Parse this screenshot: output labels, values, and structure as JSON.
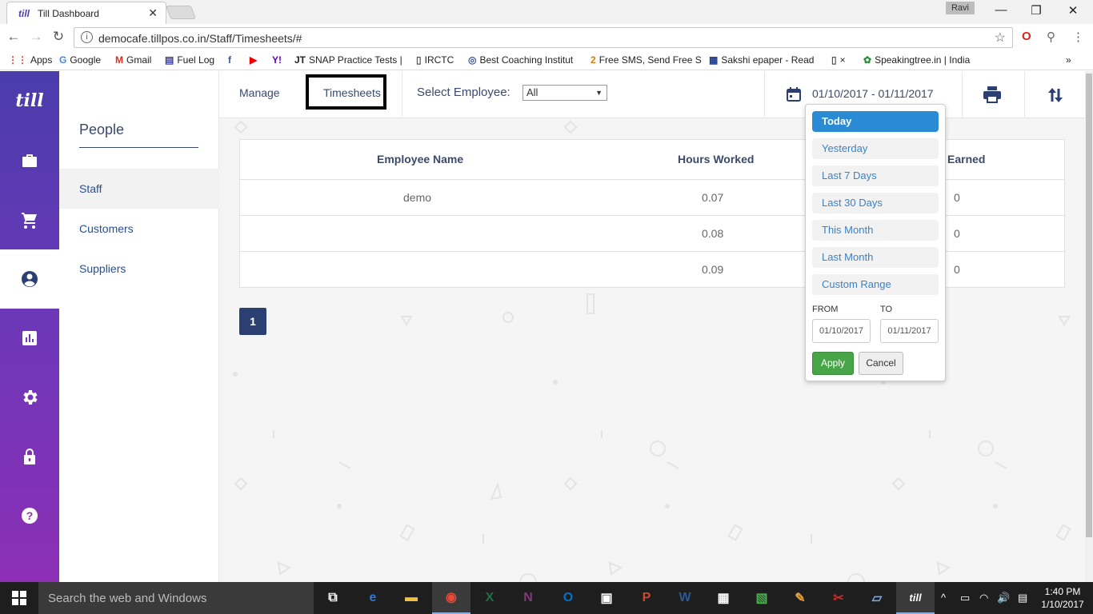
{
  "browser": {
    "tab_title": "Till Dashboard",
    "tab_favicon": "till",
    "close_glyph": "✕",
    "profile_name": "Ravi",
    "url": "democafe.tillpos.co.in/Staff/Timesheets/#",
    "window_controls": {
      "minimize": "—",
      "restore": "❐",
      "close": "✕"
    },
    "nav": {
      "back": "←",
      "forward": "→",
      "reload": "↻"
    },
    "star": "☆",
    "overflow": "⋮",
    "bookmarks_overflow": "»"
  },
  "bookmarks": [
    {
      "label": "Apps",
      "icon": "apps-grid-icon",
      "glyph": "⋮⋮",
      "color": "#e0452b"
    },
    {
      "label": "Google",
      "icon": "google-icon",
      "glyph": "G",
      "color": "#4285f4"
    },
    {
      "label": "Gmail",
      "icon": "gmail-icon",
      "glyph": "M",
      "color": "#d93025"
    },
    {
      "label": "Fuel Log",
      "icon": "fuel-log-icon",
      "glyph": "▤",
      "color": "#3a3a9a"
    },
    {
      "label": "",
      "icon": "facebook-icon",
      "glyph": "f",
      "color": "#3b5998"
    },
    {
      "label": "",
      "icon": "youtube-icon",
      "glyph": "▶",
      "color": "#e00"
    },
    {
      "label": "",
      "icon": "yahoo-icon",
      "glyph": "Y!",
      "color": "#6001d2"
    },
    {
      "label": "SNAP Practice Tests |",
      "icon": "jt-icon",
      "glyph": "JT",
      "color": "#222"
    },
    {
      "label": "IRCTC",
      "icon": "page-icon",
      "glyph": "▯",
      "color": "#555"
    },
    {
      "label": "Best Coaching Institut",
      "icon": "coaching-icon",
      "glyph": "◎",
      "color": "#3a5a9a"
    },
    {
      "label": "Free SMS, Send Free S",
      "icon": "sms-icon",
      "glyph": "2",
      "color": "#e07b00"
    },
    {
      "label": "Sakshi epaper - Read",
      "icon": "sakshi-icon",
      "glyph": "▦",
      "color": "#1a3a8a"
    },
    {
      "label": "×",
      "icon": "page-icon",
      "glyph": "▯",
      "color": "#555"
    },
    {
      "label": "Speakingtree.in | India",
      "icon": "tree-icon",
      "glyph": "✿",
      "color": "#2a8a3a"
    }
  ],
  "app": {
    "logo": "till",
    "rail": [
      {
        "name": "rail-sales",
        "icon": "briefcase-icon",
        "active": false
      },
      {
        "name": "rail-cart",
        "icon": "cart-icon",
        "active": false
      },
      {
        "name": "rail-people",
        "icon": "person-icon",
        "active": true
      },
      {
        "name": "rail-reports",
        "icon": "chart-icon",
        "active": false
      },
      {
        "name": "rail-settings",
        "icon": "gear-icon",
        "active": false
      },
      {
        "name": "rail-lock",
        "icon": "lock-icon",
        "active": false
      },
      {
        "name": "rail-help",
        "icon": "help-icon",
        "active": false
      }
    ],
    "subnav_title": "People",
    "subnav_items": [
      "Staff",
      "Customers",
      "Suppliers"
    ],
    "topbar": {
      "tab_manage": "Manage",
      "tab_timesheets": "Timesheets",
      "select_label": "Select Employee:",
      "select_value": "All",
      "date_range": "01/10/2017 - 01/11/2017"
    },
    "table": {
      "headers": [
        "Employee Name",
        "Hours Worked",
        "Earned"
      ],
      "rows": [
        {
          "name": "demo",
          "hours": "0.07",
          "earned": "0"
        },
        {
          "name": "",
          "hours": "0.08",
          "earned": "0"
        },
        {
          "name": "",
          "hours": "0.09",
          "earned": "0"
        }
      ]
    },
    "pagination": {
      "current": "1"
    },
    "date_picker": {
      "ranges": [
        "Today",
        "Yesterday",
        "Last 7 Days",
        "Last 30 Days",
        "This Month",
        "Last Month",
        "Custom Range"
      ],
      "from_label": "FROM",
      "to_label": "TO",
      "from_value": "01/10/2017",
      "to_value": "01/11/2017",
      "apply": "Apply",
      "cancel": "Cancel"
    }
  },
  "taskbar": {
    "search_placeholder": "Search the web and Windows",
    "time": "1:40 PM",
    "date": "1/10/2017",
    "apps": [
      {
        "name": "task-view-icon",
        "glyph": "⧉",
        "color": "#fff",
        "running": false
      },
      {
        "name": "edge-icon",
        "glyph": "e",
        "color": "#3277d3",
        "running": false
      },
      {
        "name": "file-explorer-icon",
        "glyph": "▬",
        "color": "#f0c040",
        "running": false
      },
      {
        "name": "chrome-icon",
        "glyph": "◉",
        "color": "#e84a3a",
        "running": true
      },
      {
        "name": "excel-icon",
        "glyph": "X",
        "color": "#1e7145",
        "running": false
      },
      {
        "name": "onenote-icon",
        "glyph": "N",
        "color": "#80397b",
        "running": false
      },
      {
        "name": "outlook-icon",
        "glyph": "O",
        "color": "#0072c6",
        "running": false
      },
      {
        "name": "store-icon",
        "glyph": "▣",
        "color": "#fff",
        "running": false
      },
      {
        "name": "powerpoint-icon",
        "glyph": "P",
        "color": "#d24726",
        "running": false
      },
      {
        "name": "word-icon",
        "glyph": "W",
        "color": "#2b5797",
        "running": false
      },
      {
        "name": "calculator-icon",
        "glyph": "▦",
        "color": "#fff",
        "running": false
      },
      {
        "name": "photos-icon",
        "glyph": "▧",
        "color": "#4caf50",
        "running": false
      },
      {
        "name": "paint-icon",
        "glyph": "✎",
        "color": "#e0a040",
        "running": false
      },
      {
        "name": "tools-icon",
        "glyph": "✂",
        "color": "#c03030",
        "running": false
      },
      {
        "name": "notes-icon",
        "glyph": "▱",
        "color": "#8ad",
        "running": false
      },
      {
        "name": "till-icon",
        "glyph": "till",
        "color": "#fff",
        "running": true
      }
    ],
    "tray": [
      "^",
      "▭",
      "◠",
      "🔊",
      "▤"
    ]
  }
}
